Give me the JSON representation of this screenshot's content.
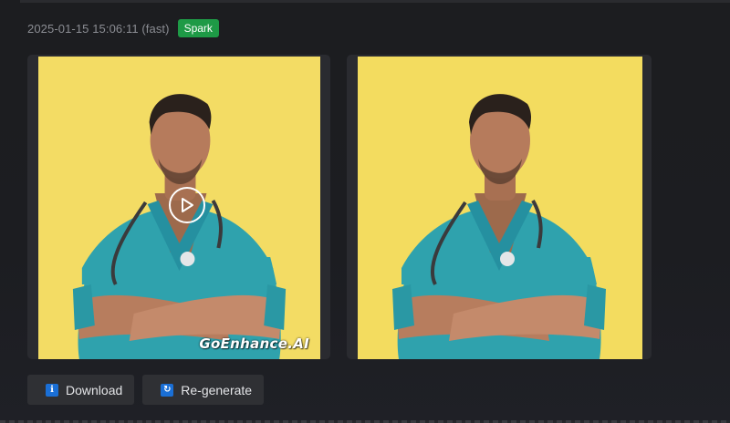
{
  "meta": {
    "timestamp": "2025-01-15 15:06:11 (fast)",
    "badge": "Spark"
  },
  "preview_left": {
    "watermark": "GoEnhance.AI",
    "play_icon": "play-icon"
  },
  "preview_right": {},
  "actions": {
    "download_label": "Download",
    "download_icon": "download-icon",
    "regenerate_label": "Re-generate",
    "regenerate_icon": "refresh-icon"
  },
  "colors": {
    "badge": "#1e9a46",
    "photo_background": "#f2da5c",
    "scrubs": "#2fa2ad",
    "icon_accent": "#1a6fd6"
  }
}
